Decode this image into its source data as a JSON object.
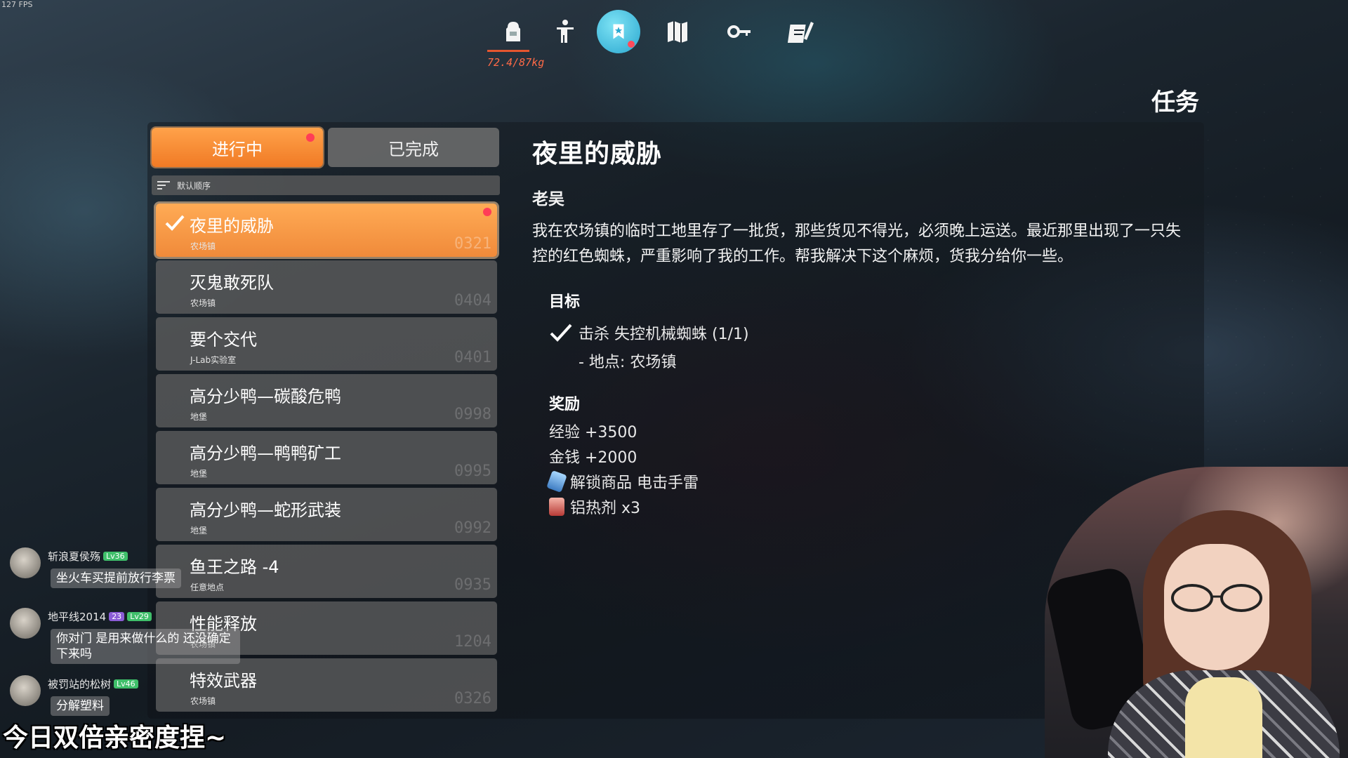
{
  "fps": "127 FPS",
  "nav": {
    "weight": "72.4/87kg",
    "icons": [
      "backpack-icon",
      "character-icon",
      "quest-icon",
      "map-icon",
      "key-icon",
      "notes-icon"
    ]
  },
  "page_title": "任务",
  "tabs": {
    "in_progress": "进行中",
    "completed": "已完成"
  },
  "sort_label": "默认顺序",
  "quests": [
    {
      "title": "夜里的威胁",
      "location": "农场镇",
      "code": "0321",
      "selected": true
    },
    {
      "title": "灭鬼敢死队",
      "location": "农场镇",
      "code": "0404"
    },
    {
      "title": "要个交代",
      "location": "J-Lab实验室",
      "code": "0401"
    },
    {
      "title": "高分少鸭—碳酸危鸭",
      "location": "地堡",
      "code": "0998"
    },
    {
      "title": "高分少鸭—鸭鸭矿工",
      "location": "地堡",
      "code": "0995"
    },
    {
      "title": "高分少鸭—蛇形武装",
      "location": "地堡",
      "code": "0992"
    },
    {
      "title": "鱼王之路 -4",
      "location": "任意地点",
      "code": "0935"
    },
    {
      "title": "性能释放",
      "location": "农场镇",
      "code": "1204"
    },
    {
      "title": "特效武器",
      "location": "农场镇",
      "code": "0326"
    }
  ],
  "detail": {
    "title": "夜里的威胁",
    "giver": "老吴",
    "description": "我在农场镇的临时工地里存了一批货，那些货见不得光，必须晚上运送。最近那里出现了一只失控的红色蜘蛛，严重影响了我的工作。帮我解决下这个麻烦，货我分给你一些。",
    "objective_heading": "目标",
    "objective": "击杀 失控机械蜘蛛 (1/1)",
    "objective_location": "- 地点: 农场镇",
    "reward_heading": "奖励",
    "reward_exp": "经验 +3500",
    "reward_money": "金钱 +2000",
    "reward_unlock": "解锁商品 电击手雷",
    "reward_item": "铝热剂 x3"
  },
  "chat": [
    {
      "user": "斩浪夏侯殇",
      "level": "Lv36",
      "message": "坐火车买提前放行李票"
    },
    {
      "user": "地平线2014",
      "fan_level": "23",
      "level": "Lv29",
      "message": "你对门 是用来做什么的 还没确定下来吗"
    },
    {
      "user": "被罚站的松树",
      "level": "Lv46",
      "message": "分解塑料"
    }
  ],
  "caption": "今日双倍亲密度捏~",
  "colors": {
    "accent": "#f08a3a",
    "active_tab": "#ffa24a",
    "notify_dot": "#ff3d57",
    "nav_active": "#2aa7cf"
  }
}
